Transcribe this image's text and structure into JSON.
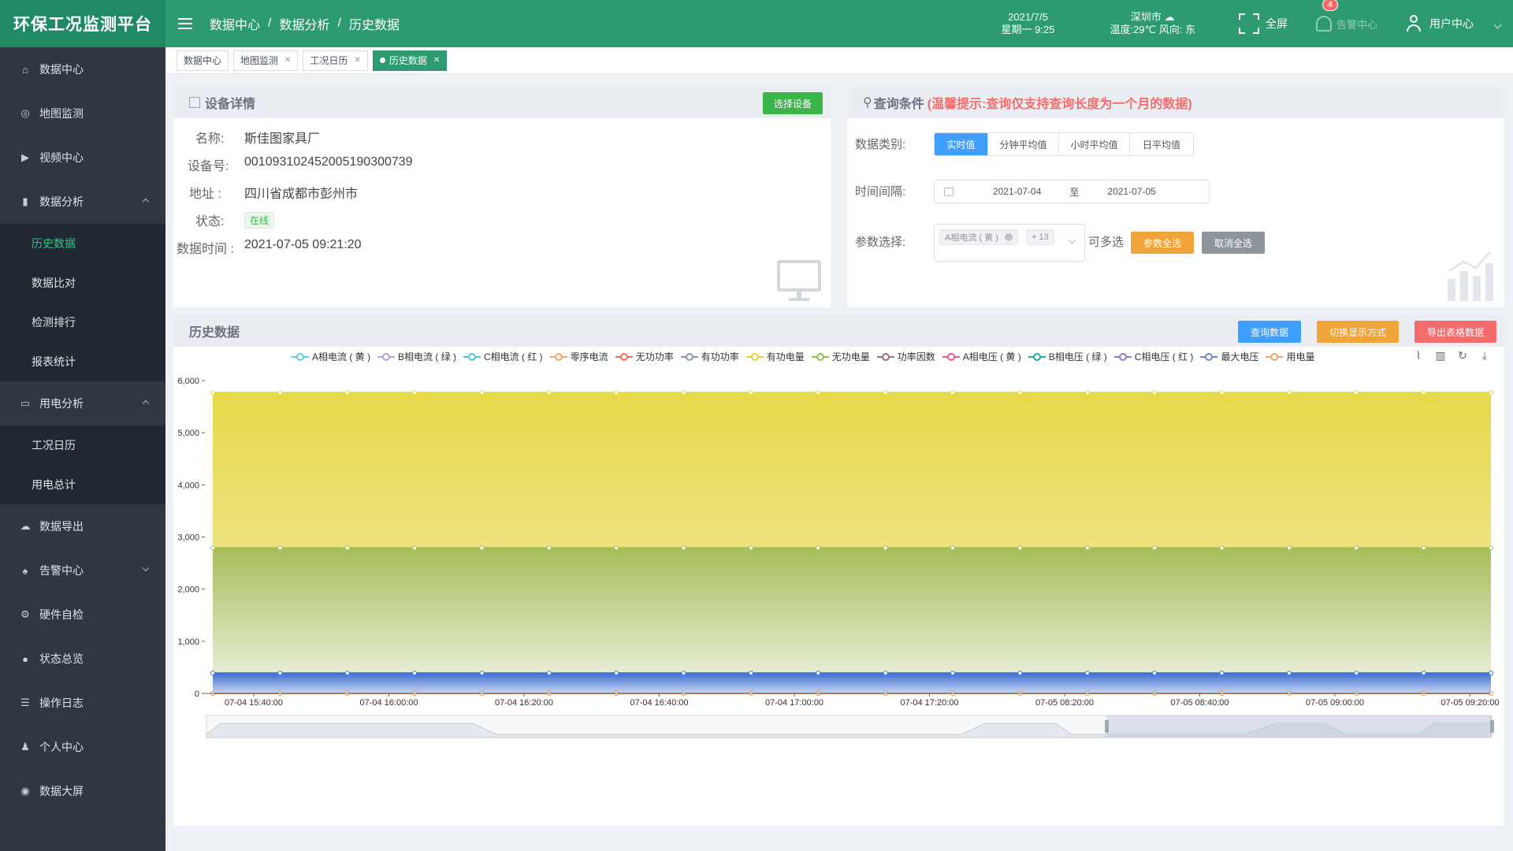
{
  "app": {
    "title": "环保工况监测平台"
  },
  "header": {
    "breadcrumb": [
      "数据中心",
      "数据分析",
      "历史数据"
    ],
    "date": "2021/7/5",
    "weekday_time": "星期一 9:25",
    "city": "深圳市",
    "weather_text": "温度:29℃ 风向: 东",
    "fullscreen_label": "全屏",
    "alarm_label": "告警中心",
    "alarm_count": "4",
    "user_label": "用户中心"
  },
  "sidebar": {
    "items": [
      {
        "label": "数据中心",
        "icon": "home-icon"
      },
      {
        "label": "地图监测",
        "icon": "map-icon"
      },
      {
        "label": "视频中心",
        "icon": "video-icon"
      },
      {
        "label": "数据分析",
        "icon": "bar-chart-icon",
        "expanded": true,
        "children": [
          "历史数据",
          "数据比对",
          "检测排行",
          "报表统计"
        ]
      },
      {
        "label": "用电分析",
        "icon": "monitor-icon",
        "expanded": true,
        "children": [
          "工况日历",
          "用电总计"
        ]
      },
      {
        "label": "数据导出",
        "icon": "cloud-download-icon"
      },
      {
        "label": "告警中心",
        "icon": "bell-icon"
      },
      {
        "label": "硬件自检",
        "icon": "chip-icon"
      },
      {
        "label": "状态总览",
        "icon": "status-icon"
      },
      {
        "label": "操作日志",
        "icon": "log-icon"
      },
      {
        "label": "个人中心",
        "icon": "user-icon"
      },
      {
        "label": "数据大屏",
        "icon": "screen-icon"
      }
    ],
    "active_child": "历史数据"
  },
  "tabs": [
    {
      "label": "数据中心",
      "closable": false
    },
    {
      "label": "地图监测",
      "closable": true
    },
    {
      "label": "工况日历",
      "closable": true
    },
    {
      "label": "历史数据",
      "closable": true,
      "active": true
    }
  ],
  "device": {
    "title": "设备详情",
    "select_button": "选择设备",
    "name_label": "名称:",
    "name": "斯佳图家具厂",
    "id_label": "设备号:",
    "id": "001093102452005190300739",
    "addr_label": "地址 :",
    "address": "四川省成都市彭州市",
    "status_label": "状态:",
    "status": "在线",
    "time_label": "数据时间 :",
    "time": "2021-07-05 09:21:20"
  },
  "query": {
    "title": "查询条件",
    "hint": "(温馨提示:查询仅支持查询长度为一个月的数据)",
    "type_label": "数据类别:",
    "types": [
      "实时值",
      "分钟平均值",
      "小时平均值",
      "日平均值"
    ],
    "active_type": "实时值",
    "interval_label": "时间间隔:",
    "start_date": "2021-07-04",
    "range_sep": "至",
    "end_date": "2021-07-05",
    "param_label": "参数选择:",
    "param_tag": "A相电流 ( 黄 )",
    "param_more": "+ 13",
    "multi_label": "可多选",
    "select_all": "参数全选",
    "deselect_all": "取消全选"
  },
  "history": {
    "title": "历史数据",
    "query_button": "查询数据",
    "switch_button": "切换显示方式",
    "export_button": "导出表格数据"
  },
  "chart_data": {
    "type": "area",
    "x": [
      "07-04 15:40:00",
      "07-04 16:00:00",
      "07-04 16:20:00",
      "07-04 16:40:00",
      "07-04 17:00:00",
      "07-04 17:20:00",
      "07-05 08:20:00",
      "07-05 08:40:00",
      "07-05 09:00:00",
      "07-05 09:20:00"
    ],
    "ylim": [
      0,
      6000
    ],
    "yticks": [
      "6,000",
      "5,000",
      "4,000",
      "3,000",
      "2,000",
      "1,000",
      "0"
    ],
    "legend": [
      {
        "name": "A相电流 ( 黄 )",
        "color": "#5ad0d6"
      },
      {
        "name": "B相电流 ( 绿 )",
        "color": "#b39ddb"
      },
      {
        "name": "C相电流 ( 红 )",
        "color": "#4fc3e6"
      },
      {
        "name": "零序电流",
        "color": "#f5a46b"
      },
      {
        "name": "无功功率",
        "color": "#ef6b61"
      },
      {
        "name": "有功功率",
        "color": "#8a96a8"
      },
      {
        "name": "有功电量",
        "color": "#e8cf3a"
      },
      {
        "name": "无功电量",
        "color": "#8bc34a"
      },
      {
        "name": "功率因数",
        "color": "#9b6a8a"
      },
      {
        "name": "A相电压 ( 黄 )",
        "color": "#ef5a8c"
      },
      {
        "name": "B相电压 ( 绿 )",
        "color": "#26a6a0"
      },
      {
        "name": "C相电压 ( 红 )",
        "color": "#8c7fd0"
      },
      {
        "name": "最大电压",
        "color": "#6a8cc8"
      },
      {
        "name": "用电量",
        "color": "#f0a36a"
      }
    ],
    "series": [
      {
        "name": "有功电量",
        "value": 5770,
        "color": "#e8d84a"
      },
      {
        "name": "无功电量",
        "value": 2790,
        "color": "#a6be5a"
      },
      {
        "name": "C相电流 ( 红 )",
        "value": 390,
        "color": "#3f6fd0"
      },
      {
        "name": "零序电流",
        "value": 0,
        "color": "#f08a4b"
      }
    ]
  }
}
